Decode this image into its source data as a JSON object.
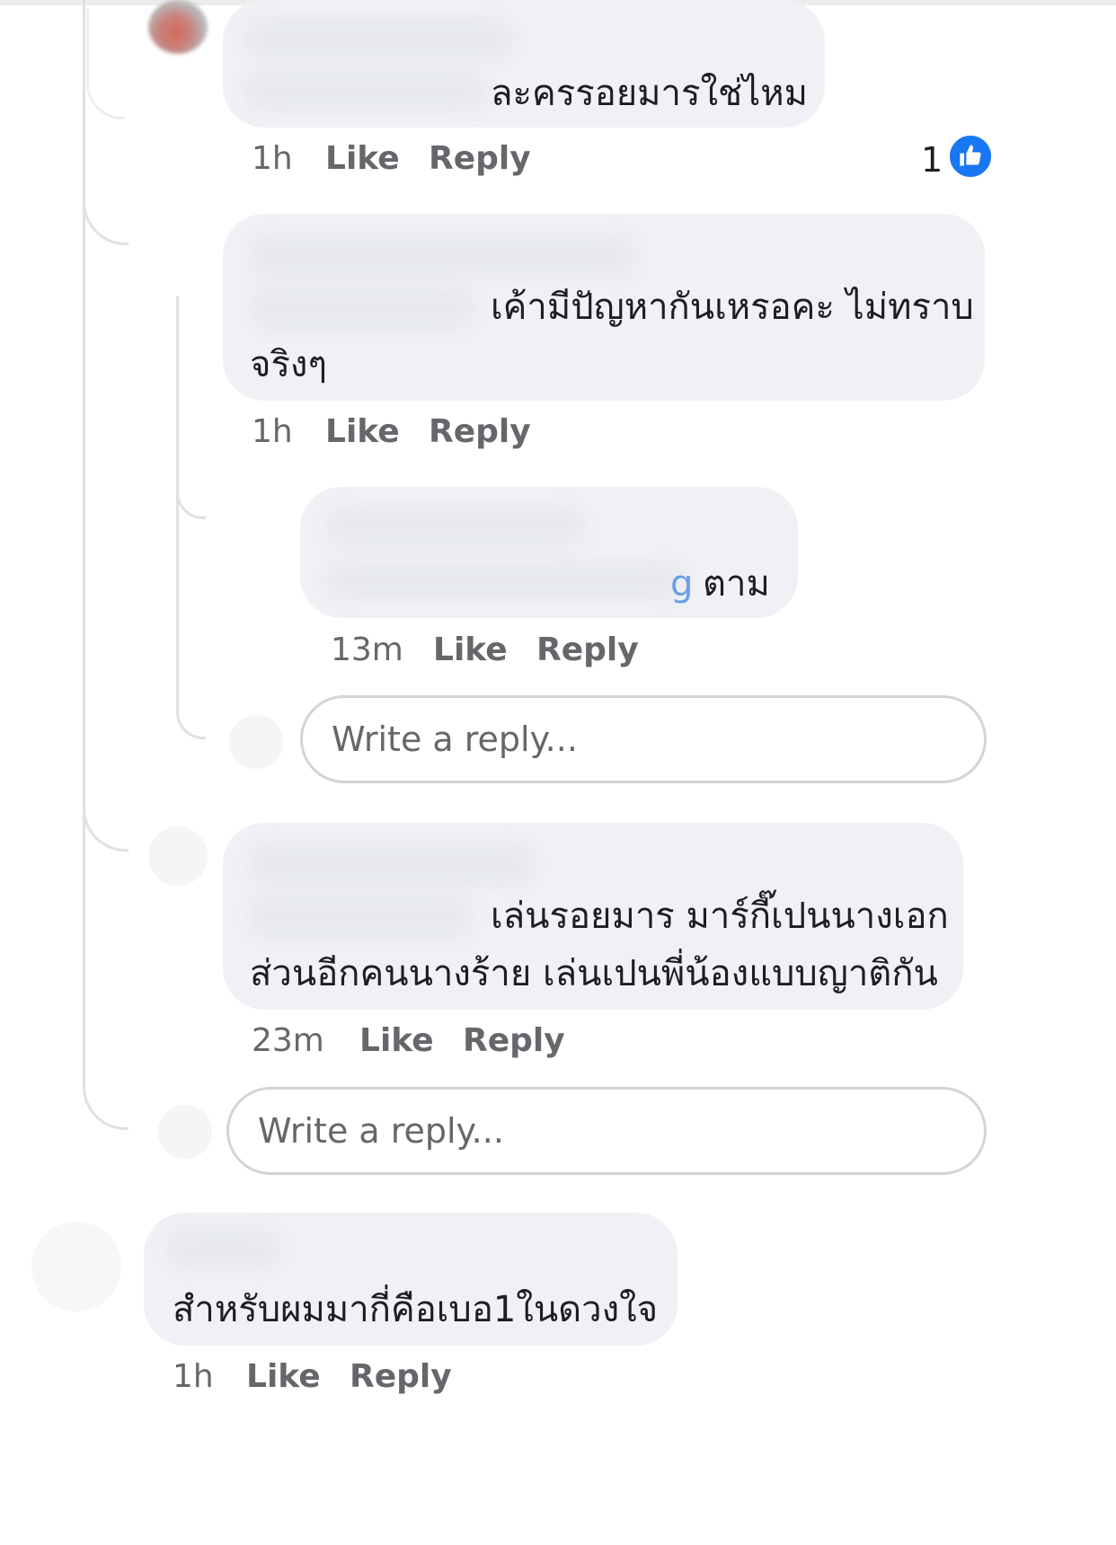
{
  "comments": [
    {
      "text_lines": [
        "ละครรอยมารใช่ไหม"
      ],
      "time": "1h",
      "like_label": "Like",
      "reply_label": "Reply",
      "reaction_count": "1",
      "reaction_icon": "like-thumb-icon"
    },
    {
      "text_lines": [
        "เค้ามีปัญหากันเหรอคะ ไม่ทราบ",
        "จริงๆ"
      ],
      "time": "1h",
      "like_label": "Like",
      "reply_label": "Reply"
    },
    {
      "name_fragment": "g",
      "text_lines": [
        "ตาม"
      ],
      "time": "13m",
      "like_label": "Like",
      "reply_label": "Reply"
    },
    {
      "text_lines": [
        "เล่นรอยมาร มาร์กี๊เปนนางเอก",
        "ส่วนอีกคนนางร้าย เล่นเปนพี่น้องแบบญาติกัน"
      ],
      "time": "23m",
      "like_label": "Like",
      "reply_label": "Reply"
    },
    {
      "text_lines": [
        "สำหรับผมมากี่คือเบอ1ในดวงใจ"
      ],
      "time": "1h",
      "like_label": "Like",
      "reply_label": "Reply"
    }
  ],
  "reply_boxes": [
    {
      "placeholder": "Write a reply..."
    },
    {
      "placeholder": "Write a reply..."
    }
  ],
  "colors": {
    "accent": "#1877f2",
    "bubble": "#eff1f5",
    "meta": "#65676b"
  }
}
